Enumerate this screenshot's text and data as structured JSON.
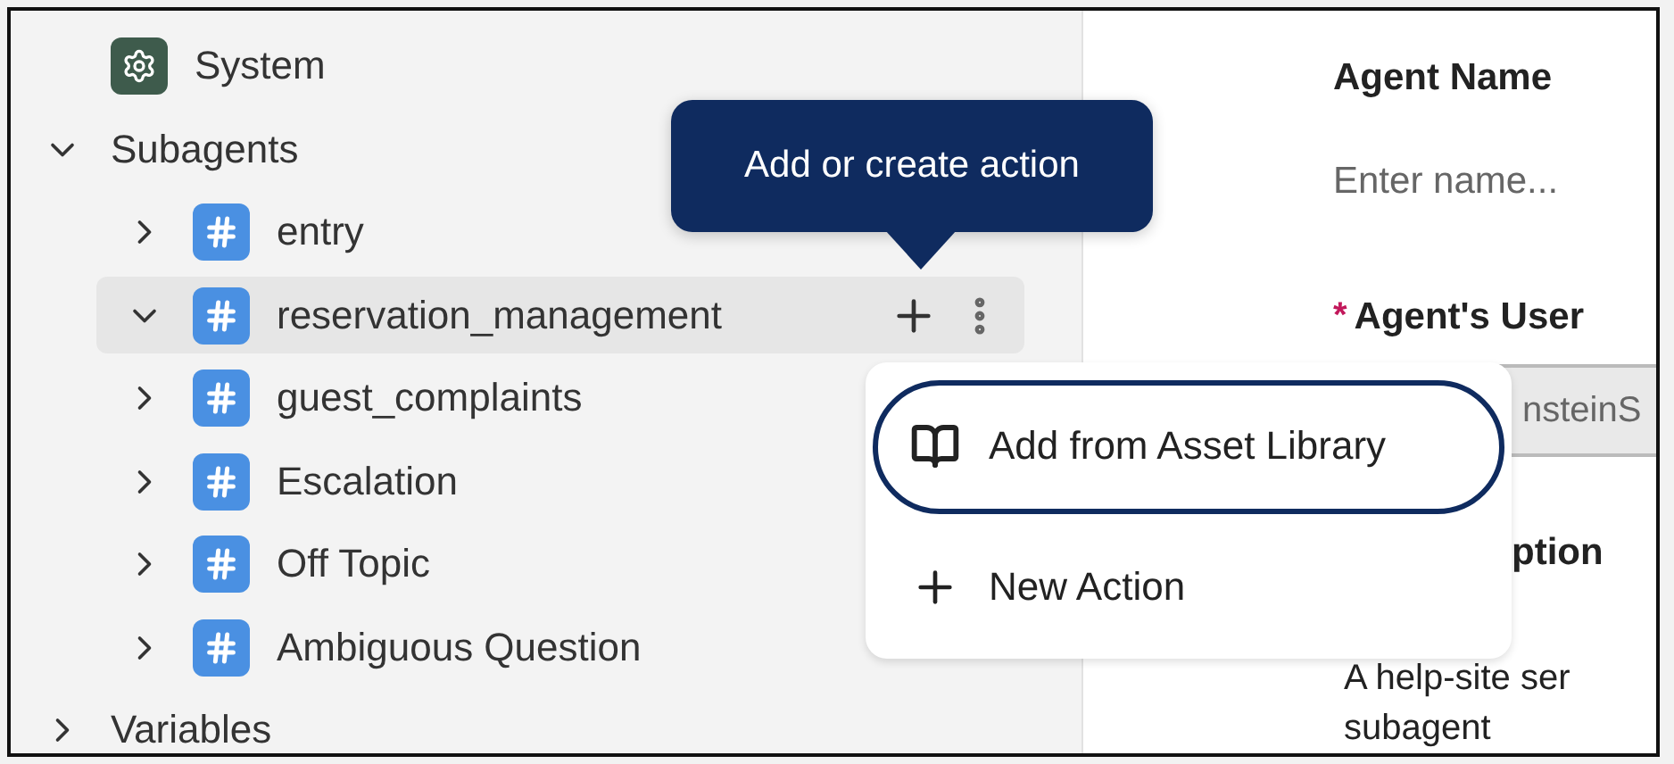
{
  "sidebar": {
    "items": [
      {
        "kind": "system",
        "label": "System"
      },
      {
        "kind": "group",
        "label": "Subagents",
        "expanded": true,
        "children": [
          {
            "label": "entry",
            "expanded": false,
            "selected": false
          },
          {
            "label": "reservation_management",
            "expanded": true,
            "selected": true
          },
          {
            "label": "guest_complaints",
            "expanded": false,
            "selected": false
          },
          {
            "label": "Escalation",
            "expanded": false,
            "selected": false
          },
          {
            "label": "Off Topic",
            "expanded": false,
            "selected": false
          },
          {
            "label": "Ambiguous Question",
            "expanded": false,
            "selected": false
          }
        ]
      },
      {
        "kind": "group",
        "label": "Variables",
        "expanded": false
      }
    ]
  },
  "tooltip": {
    "text": "Add or create action"
  },
  "action_menu": {
    "items": [
      {
        "label": "Add from Asset Library",
        "kind": "library",
        "focused": true
      },
      {
        "label": "New Action",
        "kind": "create",
        "focused": false
      }
    ]
  },
  "form": {
    "agent_name": {
      "label": "Agent Name",
      "placeholder": "Enter name..."
    },
    "user": {
      "label": "Agent's User",
      "required_mark": "*",
      "value": "nsteinS"
    },
    "description": {
      "label": "ption",
      "lines": [
        "A help-site ser",
        "subagent"
      ]
    }
  }
}
